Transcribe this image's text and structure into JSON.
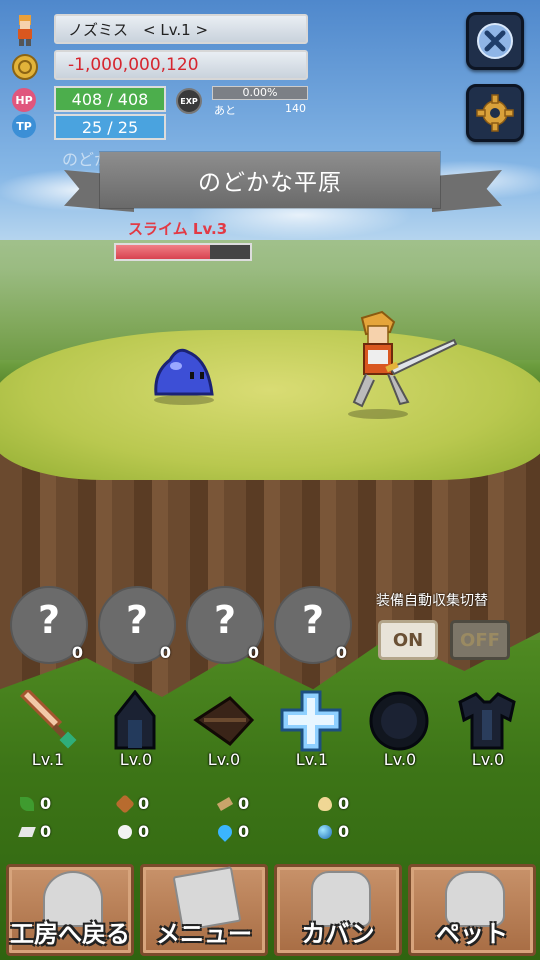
{
  "player": {
    "name_line": "ノズミス　< Lv.1 >",
    "gold": "-1,000,000,120",
    "hp": "408 / 408",
    "tp": "25 / 25",
    "exp_percent": "0.00%",
    "exp_remaining_label": "あと",
    "exp_remaining": "140"
  },
  "icons": {
    "hp_label": "HP",
    "tp_label": "TP",
    "exp_label": "EXP"
  },
  "stage": {
    "banner": "のどかな平原",
    "subtitle_faded": "のどかな平原 1 / 30"
  },
  "enemy": {
    "name": "スライム Lv.3",
    "hp_fraction": 0.7
  },
  "slots": [
    {
      "symbol": "?",
      "count": "0"
    },
    {
      "symbol": "?",
      "count": "0"
    },
    {
      "symbol": "?",
      "count": "0"
    },
    {
      "symbol": "?",
      "count": "0"
    }
  ],
  "auto_collect": {
    "title": "装備自動収集切替",
    "on_label": "ON",
    "off_label": "OFF"
  },
  "equipment": [
    {
      "level": "Lv.1",
      "icon": "sword-icon"
    },
    {
      "level": "Lv.0",
      "icon": "helmet-icon"
    },
    {
      "level": "Lv.0",
      "icon": "bow-icon"
    },
    {
      "level": "Lv.1",
      "icon": "cross-icon"
    },
    {
      "level": "Lv.0",
      "icon": "shield-icon"
    },
    {
      "level": "Lv.0",
      "icon": "armor-icon"
    }
  ],
  "resources": [
    {
      "value": "0",
      "icon": "herb-icon"
    },
    {
      "value": "0",
      "icon": "wood-icon"
    },
    {
      "value": "0",
      "icon": "lumber-icon"
    },
    {
      "value": "0",
      "icon": "egg-icon"
    },
    {
      "value": "0",
      "icon": "ingot-icon"
    },
    {
      "value": "0",
      "icon": "cotton-icon"
    },
    {
      "value": "0",
      "icon": "flame-icon"
    },
    {
      "value": "0",
      "icon": "orb-icon"
    }
  ],
  "menu": {
    "workshop": "工房へ戻る",
    "menu": "メニュー",
    "bag": "カバン",
    "pet": "ペット"
  },
  "colors": {
    "hp_bar": "#4cae4c",
    "tp_bar": "#4aa3df",
    "enemy_name": "#e23a45"
  }
}
